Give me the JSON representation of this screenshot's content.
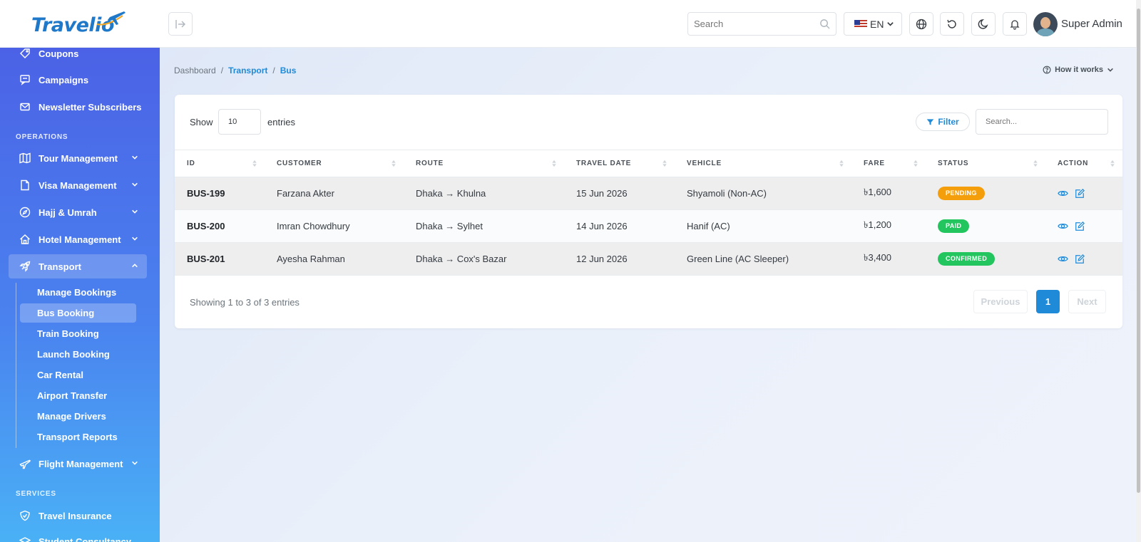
{
  "brand": {
    "name": "Travelio",
    "color": "#1f78c8"
  },
  "header": {
    "search_placeholder": "Search",
    "language": "EN",
    "user_name": "Super Admin"
  },
  "sidebar": {
    "top_items": [
      {
        "label": "Coupons",
        "icon": "tag-icon"
      },
      {
        "label": "Campaigns",
        "icon": "message-icon"
      },
      {
        "label": "Newsletter Subscribers",
        "icon": "mail-icon"
      }
    ],
    "section_operations": "OPERATIONS",
    "operations": [
      {
        "label": "Tour Management",
        "icon": "map-icon"
      },
      {
        "label": "Visa Management",
        "icon": "document-icon"
      },
      {
        "label": "Hajj & Umrah",
        "icon": "compass-icon"
      },
      {
        "label": "Hotel Management",
        "icon": "home-icon"
      },
      {
        "label": "Transport",
        "icon": "rocket-icon"
      }
    ],
    "transport_sub": [
      "Manage Bookings",
      "Bus Booking",
      "Train Booking",
      "Launch Booking",
      "Car Rental",
      "Airport Transfer",
      "Manage Drivers",
      "Transport Reports"
    ],
    "flight": {
      "label": "Flight Management",
      "icon": "plane-icon"
    },
    "section_services": "SERVICES",
    "services": [
      {
        "label": "Travel Insurance",
        "icon": "shield-icon"
      },
      {
        "label": "Student Consultancy",
        "icon": "graduation-icon"
      }
    ]
  },
  "breadcrumb": {
    "home": "Dashboard",
    "parent": "Transport",
    "current": "Bus",
    "sep": "/"
  },
  "help": {
    "label": "How it works"
  },
  "table_controls": {
    "show_label": "Show",
    "page_size": "10",
    "entries_label": "entries",
    "filter_label": "Filter",
    "search_placeholder": "Search..."
  },
  "table": {
    "columns": [
      "ID",
      "CUSTOMER",
      "ROUTE",
      "TRAVEL DATE",
      "VEHICLE",
      "FARE",
      "STATUS",
      "ACTION"
    ],
    "rows": [
      {
        "id": "BUS-199",
        "customer": "Farzana Akter",
        "route": "Dhaka → Khulna",
        "date": "15 Jun 2026",
        "vehicle": "Shyamoli (Non-AC)",
        "fare": "৳1,600",
        "status": "PENDING",
        "status_color": "#f59e0b"
      },
      {
        "id": "BUS-200",
        "customer": "Imran Chowdhury",
        "route": "Dhaka → Sylhet",
        "date": "14 Jun 2026",
        "vehicle": "Hanif (AC)",
        "fare": "৳1,200",
        "status": "PAID",
        "status_color": "#22c55e"
      },
      {
        "id": "BUS-201",
        "customer": "Ayesha Rahman",
        "route": "Dhaka → Cox's Bazar",
        "date": "12 Jun 2026",
        "vehicle": "Green Line (AC Sleeper)",
        "fare": "৳3,400",
        "status": "CONFIRMED",
        "status_color": "#22c55e"
      }
    ]
  },
  "pagination": {
    "summary": "Showing 1 to 3 of 3 entries",
    "previous": "Previous",
    "current": "1",
    "next": "Next"
  },
  "colors": {
    "accent": "#1f8ad8",
    "sidebar_top": "#4b62e6",
    "sidebar_bottom": "#4ab1f6"
  }
}
